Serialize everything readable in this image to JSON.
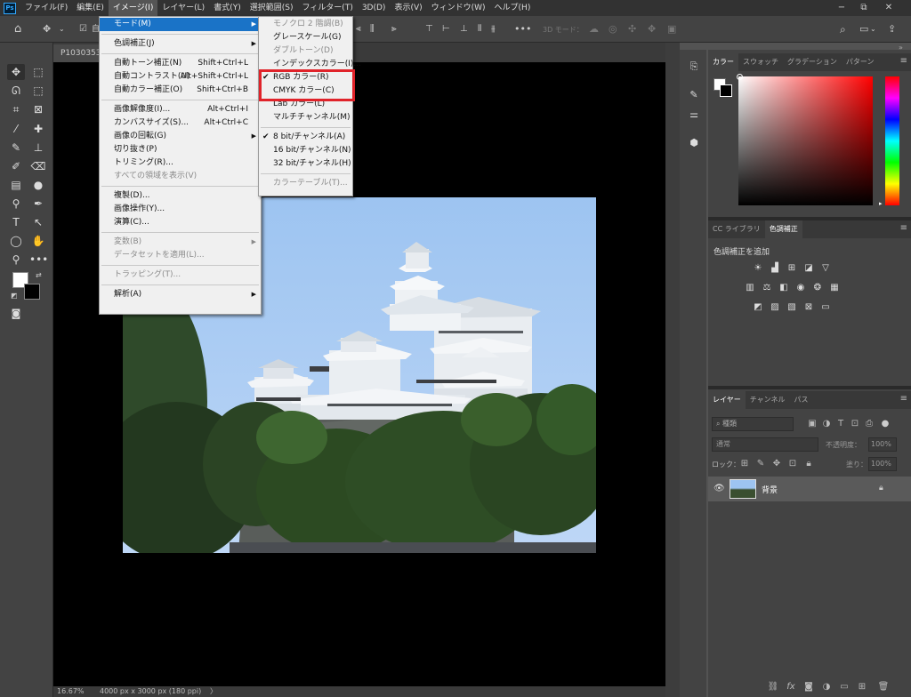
{
  "menubar": {
    "items": [
      "ファイル(F)",
      "編集(E)",
      "イメージ(I)",
      "レイヤー(L)",
      "書式(Y)",
      "選択範囲(S)",
      "フィルター(T)",
      "3D(D)",
      "表示(V)",
      "ウィンドウ(W)",
      "ヘルプ(H)"
    ],
    "active_index": 2
  },
  "window_controls": {
    "minimize": "−",
    "restore": "⧉",
    "close": "✕"
  },
  "options_bar": {
    "auto_select_label": "自",
    "mode3d_label": "3D モード："
  },
  "doc_tab": {
    "title": "P1030353"
  },
  "status": {
    "zoom": "16.67%",
    "doc_info": "4000 px x 3000 px (180 ppi)",
    "arrow": "〉"
  },
  "image_menu": {
    "items": [
      {
        "label": "モード(M)",
        "submenu": true,
        "highlighted": true
      },
      {
        "sep": true
      },
      {
        "label": "色調補正(J)",
        "submenu": true
      },
      {
        "sep": true
      },
      {
        "label": "自動トーン補正(N)",
        "shortcut": "Shift+Ctrl+L"
      },
      {
        "label": "自動コントラスト(U)",
        "shortcut": "Alt+Shift+Ctrl+L"
      },
      {
        "label": "自動カラー補正(O)",
        "shortcut": "Shift+Ctrl+B"
      },
      {
        "sep": true
      },
      {
        "label": "画像解像度(I)...",
        "shortcut": "Alt+Ctrl+I"
      },
      {
        "label": "カンバスサイズ(S)...",
        "shortcut": "Alt+Ctrl+C"
      },
      {
        "label": "画像の回転(G)",
        "submenu": true
      },
      {
        "label": "切り抜き(P)"
      },
      {
        "label": "トリミング(R)..."
      },
      {
        "label": "すべての領域を表示(V)",
        "disabled": true
      },
      {
        "sep": true
      },
      {
        "label": "複製(D)..."
      },
      {
        "label": "画像操作(Y)..."
      },
      {
        "label": "演算(C)..."
      },
      {
        "sep": true
      },
      {
        "label": "変数(B)",
        "submenu": true,
        "disabled": true
      },
      {
        "label": "データセットを適用(L)...",
        "disabled": true
      },
      {
        "sep": true
      },
      {
        "label": "トラッピング(T)...",
        "disabled": true
      },
      {
        "sep": true
      },
      {
        "label": "解析(A)",
        "submenu": true
      }
    ]
  },
  "mode_submenu": {
    "items": [
      {
        "label": "モノクロ 2 階調(B)",
        "disabled": true
      },
      {
        "label": "グレースケール(G)"
      },
      {
        "label": "ダブルトーン(D)",
        "disabled": true
      },
      {
        "label": "インデックスカラー(I)..."
      },
      {
        "label": "RGB カラー(R)",
        "checked": true
      },
      {
        "label": "CMYK カラー(C)"
      },
      {
        "label": "Lab カラー(L)"
      },
      {
        "label": "マルチチャンネル(M)"
      },
      {
        "sep": true
      },
      {
        "label": "8 bit/チャンネル(A)",
        "checked": true
      },
      {
        "label": "16 bit/チャンネル(N)"
      },
      {
        "label": "32 bit/チャンネル(H)"
      },
      {
        "sep": true
      },
      {
        "label": "カラーテーブル(T)...",
        "disabled": true
      }
    ]
  },
  "color_panel": {
    "tabs": [
      "カラー",
      "スウォッチ",
      "グラデーション",
      "パターン"
    ],
    "active": 0,
    "hue_color": "#ff0000"
  },
  "adjust_panel": {
    "tabs": [
      "CC ライブラリ",
      "色調補正"
    ],
    "active": 1,
    "heading": "色調補正を追加"
  },
  "layers_panel": {
    "tabs": [
      "レイヤー",
      "チャンネル",
      "パス"
    ],
    "active": 0,
    "filter_label": "種類",
    "blend_mode": "通常",
    "opacity_label": "不透明度：",
    "opacity_value": "100%",
    "lock_label": "ロック：",
    "fill_label": "塗り：",
    "fill_value": "100%",
    "layer_name": "背景"
  }
}
